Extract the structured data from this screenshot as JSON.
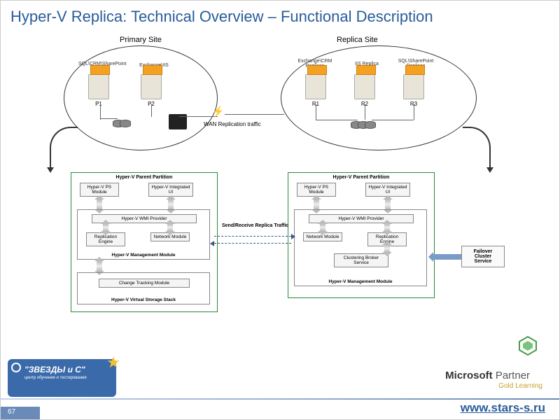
{
  "title": "Hyper-V Replica: Technical Overview – Functional Description",
  "slide_number": "67",
  "url": "www.stars-s.ru",
  "primary_site": {
    "label": "Primary Site",
    "servers": [
      {
        "id": "P1",
        "stack": "SQL\\CRM\\SharePoint"
      },
      {
        "id": "P2",
        "stack": "Exchange\\IIS"
      }
    ]
  },
  "replica_site": {
    "label": "Replica Site",
    "servers": [
      {
        "id": "R1",
        "stack": "Exchange\\CRM Replicas"
      },
      {
        "id": "R2",
        "stack": "IIS Replica"
      },
      {
        "id": "R3",
        "stack": "SQL\\SharePoint Replicas"
      }
    ]
  },
  "wan_label": "WAN Replication traffic",
  "partition_title": "Hyper-V Parent Partition",
  "boxes": {
    "ps": "Hyper-V PS Module",
    "ui": "Hyper-V Integrated UI",
    "wmi": "Hyper-V WMI Provider",
    "repl": "Replication Engine",
    "net": "Network Module",
    "mgmt": "Hyper-V Management Module",
    "track": "Change Tracking Module",
    "storage": "Hyper-V Virtual Storage Stack",
    "broker": "Clustering Broker Service",
    "failover": "Failover Cluster Service"
  },
  "send_label": "Send/Receive Replica Traffic",
  "logo": {
    "title": "\"ЗВЕЗДЫ и С\"",
    "subtitle": "центр обучения и тестирования"
  },
  "ms": {
    "brand": "Microsoft",
    "partner": " Partner",
    "gold": "Gold Learning"
  }
}
